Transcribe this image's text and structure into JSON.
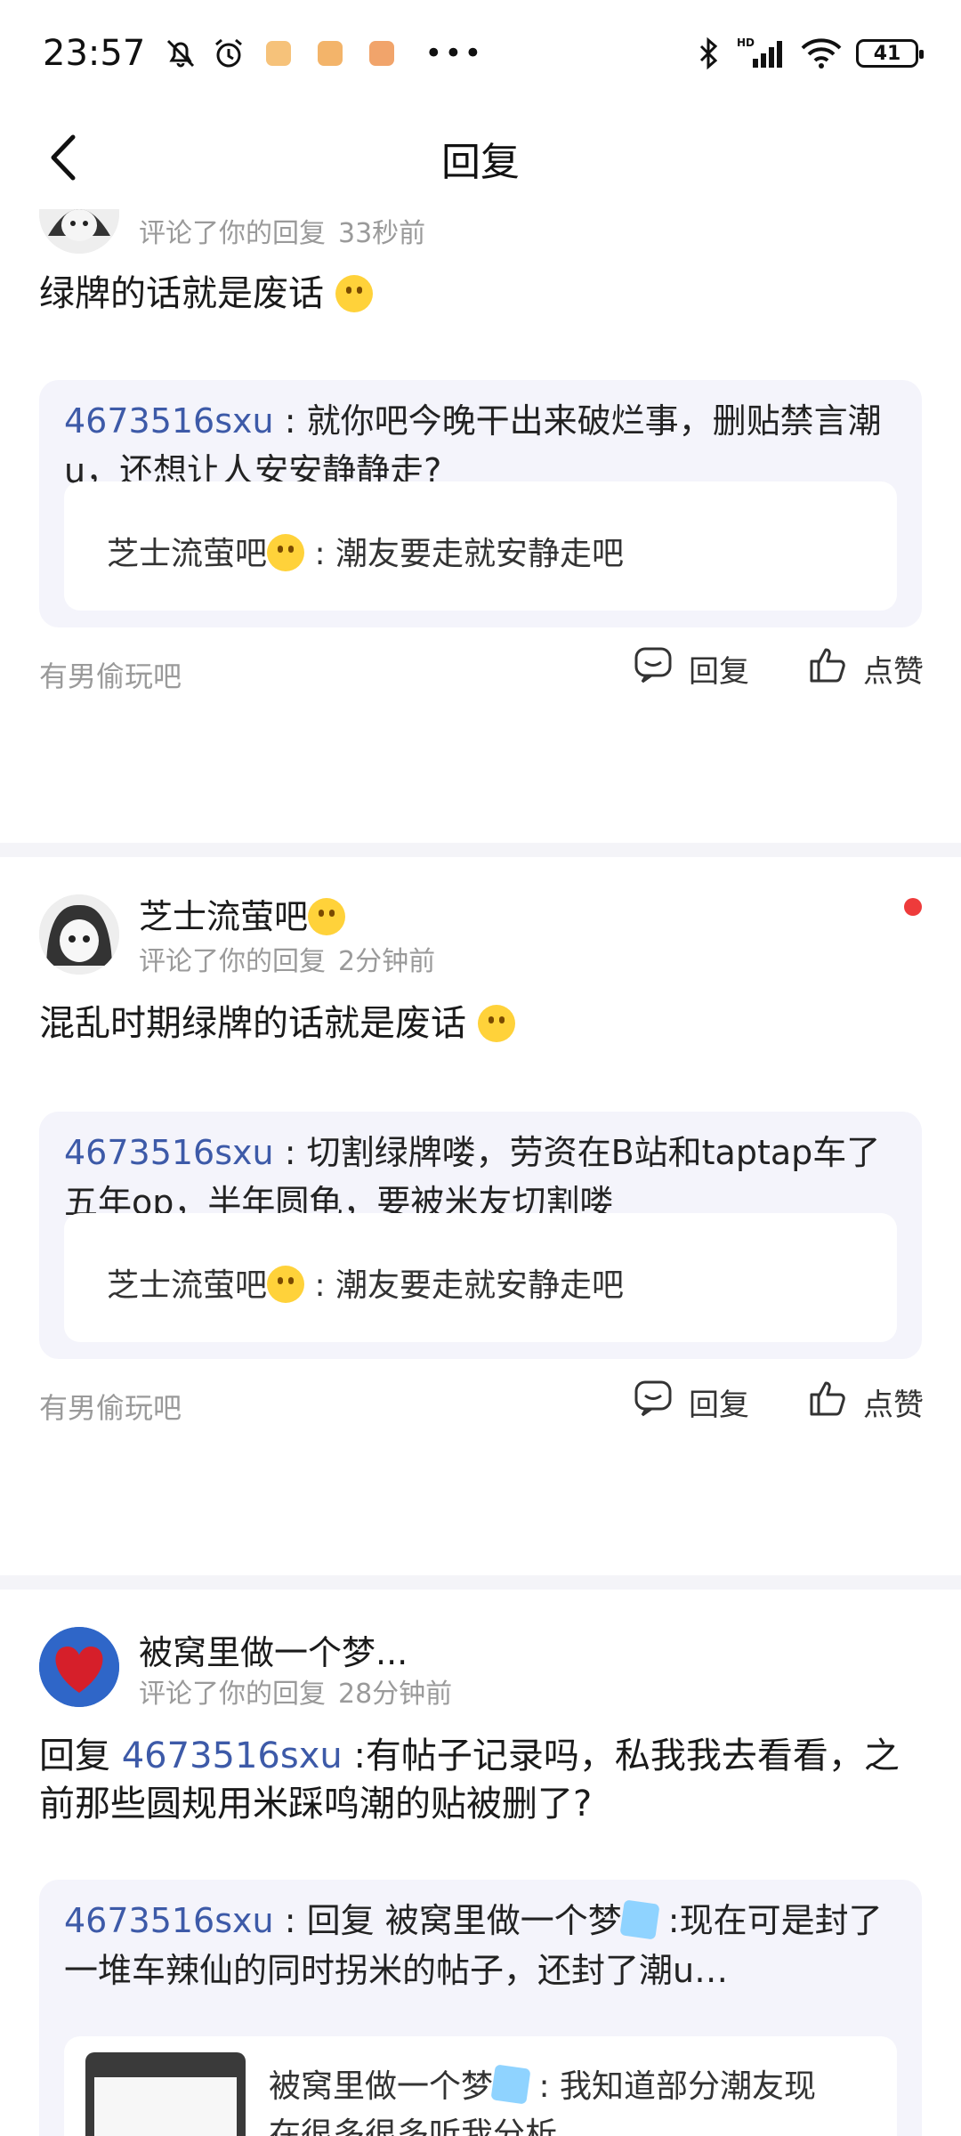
{
  "status_bar": {
    "time": "23:57",
    "battery": "41",
    "icons": [
      "mute-bell-icon",
      "alarm-icon",
      "app-icon-1",
      "app-icon-2",
      "app-icon-3",
      "more-icon",
      "bluetooth-icon",
      "hd-signal-icon",
      "wifi-icon",
      "battery-icon"
    ]
  },
  "nav": {
    "title": "回复",
    "back_icon": "back-arrow-icon"
  },
  "cards": [
    {
      "meta": "评论了你的回复",
      "time": "33秒前",
      "comment": "绿牌的话就是废话",
      "quote": {
        "user": "4673516sxu",
        "text": "就你吧今晚干出来破烂事，删贴禁言潮u，还想让人安安静静走?"
      },
      "inner": {
        "user": "芝士流萤吧",
        "text": "潮友要走就安静走吧"
      },
      "forum": "有男偷玩吧",
      "reply_label": "回复",
      "like_label": "点赞"
    },
    {
      "username": "芝士流萤吧",
      "meta": "评论了你的回复",
      "time": "2分钟前",
      "comment": "混乱时期绿牌的话就是废话",
      "quote": {
        "user": "4673516sxu",
        "text": "切割绿牌喽，劳资在B站和taptap车了五年op，半年圆龟，要被米友切割喽"
      },
      "inner": {
        "user": "芝士流萤吧",
        "text": "潮友要走就安静走吧"
      },
      "forum": "有男偷玩吧",
      "reply_label": "回复",
      "like_label": "点赞"
    },
    {
      "username": "被窝里做一个梦...",
      "meta": "评论了你的回复",
      "time": "28分钟前",
      "comment_prefix": "回复",
      "comment_mention": "4673516sxu",
      "comment": ":有帖子记录吗，私我我去看看，之前那些圆规用米踩鸣潮的贴被删了?",
      "quote": {
        "user": "4673516sxu",
        "prefix": "回复",
        "mention": "被窝里做一个梦",
        "text": ":现在可是封了一堆车辣仙的同时拐米的帖子，还封了潮u…"
      },
      "inner": {
        "user": "被窝里做一个梦",
        "text": "我知道部分潮友现",
        "text2": "在很多很多听我分析"
      }
    }
  ]
}
